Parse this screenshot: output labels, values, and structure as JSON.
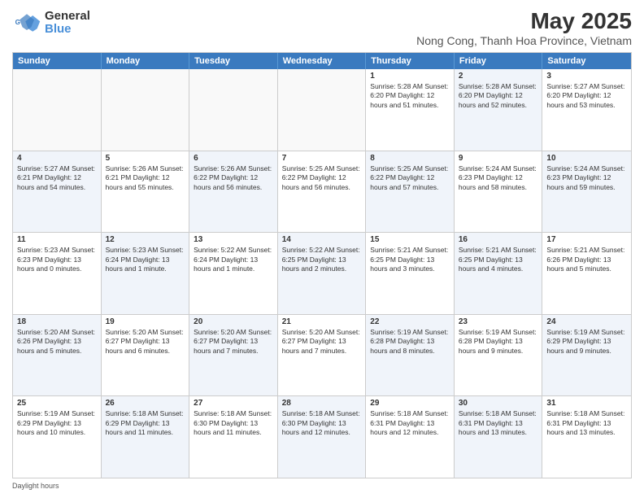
{
  "logo": {
    "line1": "General",
    "line2": "Blue"
  },
  "title": "May 2025",
  "subtitle": "Nong Cong, Thanh Hoa Province, Vietnam",
  "days_of_week": [
    "Sunday",
    "Monday",
    "Tuesday",
    "Wednesday",
    "Thursday",
    "Friday",
    "Saturday"
  ],
  "footer": "Daylight hours",
  "weeks": [
    [
      {
        "day": "",
        "text": "",
        "alt": false,
        "empty": true
      },
      {
        "day": "",
        "text": "",
        "alt": false,
        "empty": true
      },
      {
        "day": "",
        "text": "",
        "alt": false,
        "empty": true
      },
      {
        "day": "",
        "text": "",
        "alt": false,
        "empty": true
      },
      {
        "day": "1",
        "text": "Sunrise: 5:28 AM\nSunset: 6:20 PM\nDaylight: 12 hours\nand 51 minutes.",
        "alt": false,
        "empty": false
      },
      {
        "day": "2",
        "text": "Sunrise: 5:28 AM\nSunset: 6:20 PM\nDaylight: 12 hours\nand 52 minutes.",
        "alt": true,
        "empty": false
      },
      {
        "day": "3",
        "text": "Sunrise: 5:27 AM\nSunset: 6:20 PM\nDaylight: 12 hours\nand 53 minutes.",
        "alt": false,
        "empty": false
      }
    ],
    [
      {
        "day": "4",
        "text": "Sunrise: 5:27 AM\nSunset: 6:21 PM\nDaylight: 12 hours\nand 54 minutes.",
        "alt": true,
        "empty": false
      },
      {
        "day": "5",
        "text": "Sunrise: 5:26 AM\nSunset: 6:21 PM\nDaylight: 12 hours\nand 55 minutes.",
        "alt": false,
        "empty": false
      },
      {
        "day": "6",
        "text": "Sunrise: 5:26 AM\nSunset: 6:22 PM\nDaylight: 12 hours\nand 56 minutes.",
        "alt": true,
        "empty": false
      },
      {
        "day": "7",
        "text": "Sunrise: 5:25 AM\nSunset: 6:22 PM\nDaylight: 12 hours\nand 56 minutes.",
        "alt": false,
        "empty": false
      },
      {
        "day": "8",
        "text": "Sunrise: 5:25 AM\nSunset: 6:22 PM\nDaylight: 12 hours\nand 57 minutes.",
        "alt": true,
        "empty": false
      },
      {
        "day": "9",
        "text": "Sunrise: 5:24 AM\nSunset: 6:23 PM\nDaylight: 12 hours\nand 58 minutes.",
        "alt": false,
        "empty": false
      },
      {
        "day": "10",
        "text": "Sunrise: 5:24 AM\nSunset: 6:23 PM\nDaylight: 12 hours\nand 59 minutes.",
        "alt": true,
        "empty": false
      }
    ],
    [
      {
        "day": "11",
        "text": "Sunrise: 5:23 AM\nSunset: 6:23 PM\nDaylight: 13 hours\nand 0 minutes.",
        "alt": false,
        "empty": false
      },
      {
        "day": "12",
        "text": "Sunrise: 5:23 AM\nSunset: 6:24 PM\nDaylight: 13 hours\nand 1 minute.",
        "alt": true,
        "empty": false
      },
      {
        "day": "13",
        "text": "Sunrise: 5:22 AM\nSunset: 6:24 PM\nDaylight: 13 hours\nand 1 minute.",
        "alt": false,
        "empty": false
      },
      {
        "day": "14",
        "text": "Sunrise: 5:22 AM\nSunset: 6:25 PM\nDaylight: 13 hours\nand 2 minutes.",
        "alt": true,
        "empty": false
      },
      {
        "day": "15",
        "text": "Sunrise: 5:21 AM\nSunset: 6:25 PM\nDaylight: 13 hours\nand 3 minutes.",
        "alt": false,
        "empty": false
      },
      {
        "day": "16",
        "text": "Sunrise: 5:21 AM\nSunset: 6:25 PM\nDaylight: 13 hours\nand 4 minutes.",
        "alt": true,
        "empty": false
      },
      {
        "day": "17",
        "text": "Sunrise: 5:21 AM\nSunset: 6:26 PM\nDaylight: 13 hours\nand 5 minutes.",
        "alt": false,
        "empty": false
      }
    ],
    [
      {
        "day": "18",
        "text": "Sunrise: 5:20 AM\nSunset: 6:26 PM\nDaylight: 13 hours\nand 5 minutes.",
        "alt": true,
        "empty": false
      },
      {
        "day": "19",
        "text": "Sunrise: 5:20 AM\nSunset: 6:27 PM\nDaylight: 13 hours\nand 6 minutes.",
        "alt": false,
        "empty": false
      },
      {
        "day": "20",
        "text": "Sunrise: 5:20 AM\nSunset: 6:27 PM\nDaylight: 13 hours\nand 7 minutes.",
        "alt": true,
        "empty": false
      },
      {
        "day": "21",
        "text": "Sunrise: 5:20 AM\nSunset: 6:27 PM\nDaylight: 13 hours\nand 7 minutes.",
        "alt": false,
        "empty": false
      },
      {
        "day": "22",
        "text": "Sunrise: 5:19 AM\nSunset: 6:28 PM\nDaylight: 13 hours\nand 8 minutes.",
        "alt": true,
        "empty": false
      },
      {
        "day": "23",
        "text": "Sunrise: 5:19 AM\nSunset: 6:28 PM\nDaylight: 13 hours\nand 9 minutes.",
        "alt": false,
        "empty": false
      },
      {
        "day": "24",
        "text": "Sunrise: 5:19 AM\nSunset: 6:29 PM\nDaylight: 13 hours\nand 9 minutes.",
        "alt": true,
        "empty": false
      }
    ],
    [
      {
        "day": "25",
        "text": "Sunrise: 5:19 AM\nSunset: 6:29 PM\nDaylight: 13 hours\nand 10 minutes.",
        "alt": false,
        "empty": false
      },
      {
        "day": "26",
        "text": "Sunrise: 5:18 AM\nSunset: 6:29 PM\nDaylight: 13 hours\nand 11 minutes.",
        "alt": true,
        "empty": false
      },
      {
        "day": "27",
        "text": "Sunrise: 5:18 AM\nSunset: 6:30 PM\nDaylight: 13 hours\nand 11 minutes.",
        "alt": false,
        "empty": false
      },
      {
        "day": "28",
        "text": "Sunrise: 5:18 AM\nSunset: 6:30 PM\nDaylight: 13 hours\nand 12 minutes.",
        "alt": true,
        "empty": false
      },
      {
        "day": "29",
        "text": "Sunrise: 5:18 AM\nSunset: 6:31 PM\nDaylight: 13 hours\nand 12 minutes.",
        "alt": false,
        "empty": false
      },
      {
        "day": "30",
        "text": "Sunrise: 5:18 AM\nSunset: 6:31 PM\nDaylight: 13 hours\nand 13 minutes.",
        "alt": true,
        "empty": false
      },
      {
        "day": "31",
        "text": "Sunrise: 5:18 AM\nSunset: 6:31 PM\nDaylight: 13 hours\nand 13 minutes.",
        "alt": false,
        "empty": false
      }
    ]
  ]
}
